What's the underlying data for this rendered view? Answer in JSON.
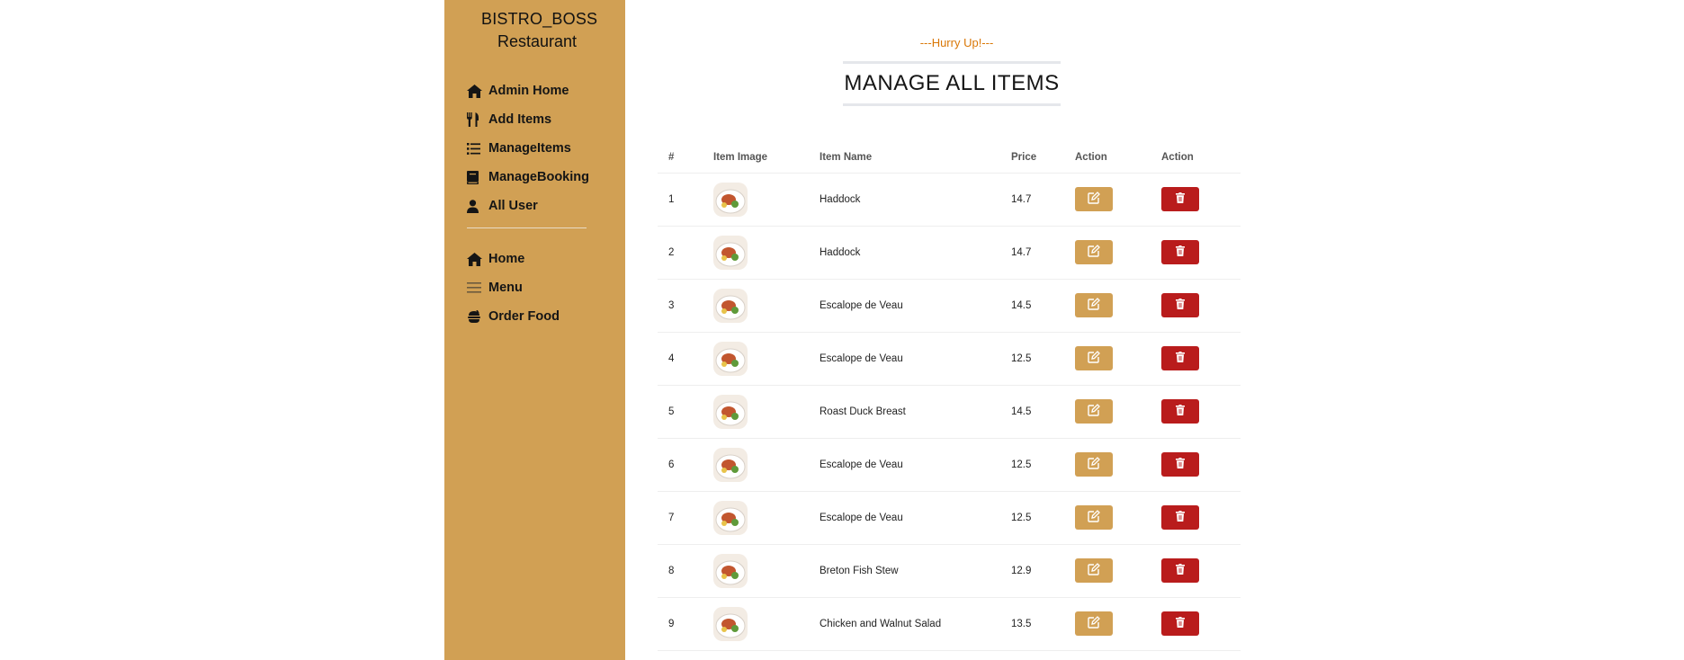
{
  "brand": {
    "line1": "BISTRO_BOSS",
    "line2": "Restaurant"
  },
  "sidebar": {
    "admin_items": [
      {
        "label": "Admin Home",
        "icon": "home-icon"
      },
      {
        "label": "Add Items",
        "icon": "utensils-icon"
      },
      {
        "label": "ManageItems",
        "icon": "list-icon"
      },
      {
        "label": "ManageBooking",
        "icon": "book-icon"
      },
      {
        "label": "All User",
        "icon": "user-icon"
      }
    ],
    "main_items": [
      {
        "label": "Home",
        "icon": "home-icon"
      },
      {
        "label": "Menu",
        "icon": "menu-icon"
      },
      {
        "label": "Order Food",
        "icon": "food-icon"
      }
    ]
  },
  "header": {
    "subtitle": "---Hurry Up!---",
    "title": "MANAGE ALL ITEMS"
  },
  "table": {
    "headers": [
      "#",
      "Item Image",
      "Item Name",
      "Price",
      "Action",
      "Action"
    ],
    "rows": [
      {
        "num": "1",
        "name": "Haddock",
        "price": "14.7"
      },
      {
        "num": "2",
        "name": "Haddock",
        "price": "14.7"
      },
      {
        "num": "3",
        "name": "Escalope de Veau",
        "price": "14.5"
      },
      {
        "num": "4",
        "name": "Escalope de Veau",
        "price": "12.5"
      },
      {
        "num": "5",
        "name": "Roast Duck Breast",
        "price": "14.5"
      },
      {
        "num": "6",
        "name": "Escalope de Veau",
        "price": "12.5"
      },
      {
        "num": "7",
        "name": "Escalope de Veau",
        "price": "12.5"
      },
      {
        "num": "8",
        "name": "Breton Fish Stew",
        "price": "12.9"
      },
      {
        "num": "9",
        "name": "Chicken and Walnut Salad",
        "price": "13.5"
      }
    ]
  },
  "colors": {
    "accent": "#d1a054",
    "danger": "#b91c1c",
    "subtitle": "#d97706"
  }
}
